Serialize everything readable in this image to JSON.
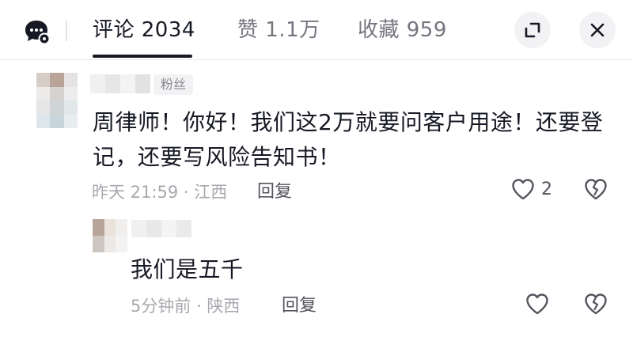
{
  "header": {
    "tabs": [
      {
        "label": "评论 2034",
        "active": true
      },
      {
        "label": "赞 1.1万",
        "active": false
      },
      {
        "label": "收藏 959",
        "active": false
      }
    ],
    "icons": {
      "settings": "comment-settings-icon",
      "expand": "expand-icon",
      "close": "close-icon"
    }
  },
  "comments": [
    {
      "badge": "粉丝",
      "text": "周律师！你好！我们这2万就要问客户用途！还要登记，还要写风险告知书！",
      "meta": "昨天 21:59 · 江西",
      "reply_label": "回复",
      "like_count": "2"
    },
    {
      "text": "我们是五千",
      "meta": "5分钟前 · 陕西",
      "reply_label": "回复",
      "like_count": ""
    }
  ],
  "colors": {
    "primary_text": "#161823",
    "secondary_text": "#a8a9ae",
    "action_text": "#53545c",
    "button_bg": "#f2f2f4"
  }
}
